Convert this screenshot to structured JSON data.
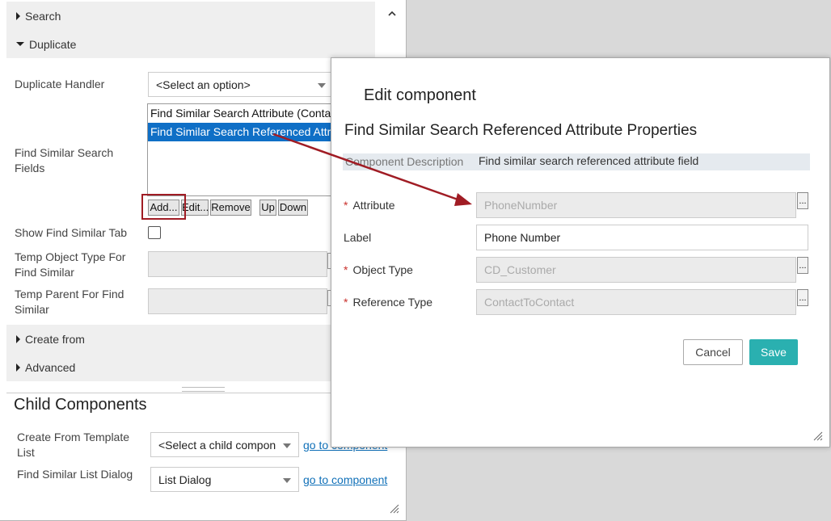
{
  "colors": {
    "accent": "#2ab0b0",
    "selection": "#0f6fc6",
    "link": "#1070b8",
    "required": "#c9302c",
    "annotation": "#a01c24"
  },
  "left_panel": {
    "sections": {
      "search": "Search",
      "duplicate": "Duplicate",
      "create_from": "Create from",
      "advanced": "Advanced"
    },
    "duplicate_handler": {
      "label": "Duplicate Handler",
      "value": "<Select an option>"
    },
    "find_similar_search_fields": {
      "label": "Find Similar Search Fields",
      "items": [
        "Find Similar Search Attribute (Contact",
        "Find Similar Search Referenced Attrib"
      ],
      "buttons": {
        "add": "Add...",
        "edit": "Edit...",
        "remove": "Remove",
        "up": "Up",
        "down": "Down"
      }
    },
    "show_find_similar_tab": {
      "label": "Show Find Similar Tab",
      "checked": false
    },
    "temp_object_type": {
      "label": "Temp Object Type For Find Similar"
    },
    "temp_parent": {
      "label": "Temp Parent For Find Similar"
    },
    "child_components": {
      "title": "Child Components",
      "create_from_template": {
        "label": "Create From Template List",
        "value": "<Select a child compon",
        "link": "go to component"
      },
      "find_similar_list_dialog": {
        "label": "Find Similar List Dialog",
        "value": "List Dialog",
        "link": "go to component"
      }
    }
  },
  "dialog": {
    "title": "Edit component",
    "subtitle": "Find Similar Search Referenced Attribute Properties",
    "description": {
      "label": "Component Description",
      "value": "Find similar search referenced attribute field"
    },
    "fields": {
      "attribute": {
        "label": "Attribute",
        "required_mark": "*",
        "value": "PhoneNumber",
        "browse": "..."
      },
      "label": {
        "label": "Label",
        "value": "Phone Number"
      },
      "object_type": {
        "label": "Object Type",
        "required_mark": "*",
        "value": "CD_Customer",
        "browse": "..."
      },
      "reference_type": {
        "label": "Reference Type",
        "required_mark": "*",
        "value": "ContactToContact",
        "browse": "..."
      }
    },
    "cancel": "Cancel",
    "save": "Save"
  }
}
